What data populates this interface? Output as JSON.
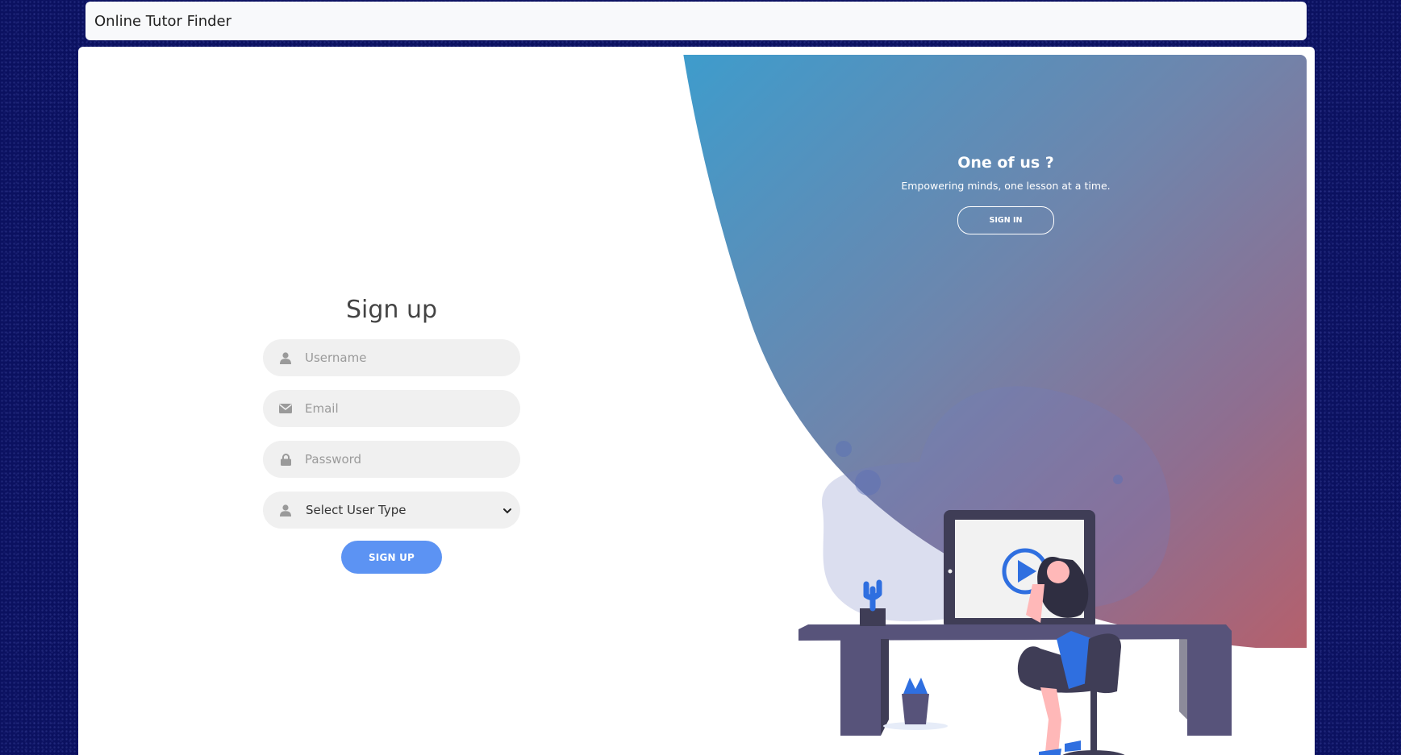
{
  "navbar": {
    "brand": "Online Tutor Finder"
  },
  "signup": {
    "title": "Sign up",
    "username_placeholder": "Username",
    "email_placeholder": "Email",
    "password_placeholder": "Password",
    "user_type_selected": "Select User Type",
    "submit_label": "SIGN UP"
  },
  "panel": {
    "title": "One of us ?",
    "subtitle": "Empowering minds, one lesson at a time.",
    "signin_label": "SIGN IN"
  },
  "icons": {
    "username": "user-icon",
    "email": "envelope-icon",
    "password": "lock-icon",
    "user_type": "user-icon",
    "select": "chevron-down-icon"
  },
  "colors": {
    "page_background": "#0b1160",
    "accent_button": "#5c93f3",
    "gradient_start": "#3f9bcc",
    "gradient_end": "#b16270"
  }
}
